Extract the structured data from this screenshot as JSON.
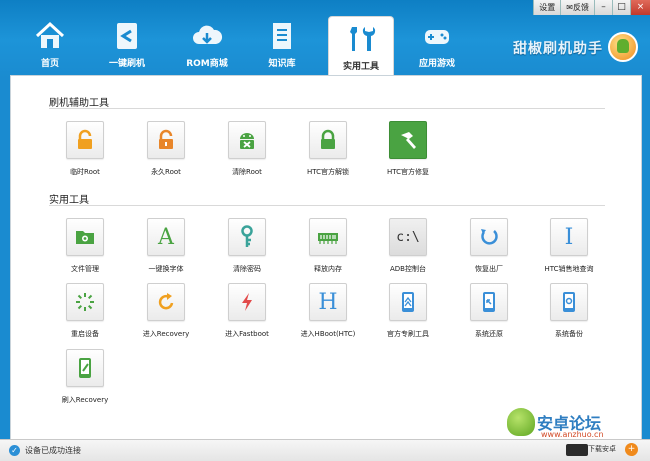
{
  "window_controls": {
    "settings": "设置",
    "feedback": "反馈",
    "minimize": "–",
    "maximize": "□",
    "close": "×"
  },
  "nav": {
    "tabs": [
      {
        "label": "首页",
        "icon": "home-icon"
      },
      {
        "label": "一键刷机",
        "icon": "flash-icon"
      },
      {
        "label": "ROM商城",
        "icon": "cloud-download-icon"
      },
      {
        "label": "知识库",
        "icon": "document-icon"
      },
      {
        "label": "实用工具",
        "icon": "tools-icon",
        "active": true
      },
      {
        "label": "应用游戏",
        "icon": "gamepad-icon"
      }
    ]
  },
  "brand": {
    "title": "甜椒刷机助手"
  },
  "sections": {
    "flash_tools": {
      "title": "刷机辅助工具",
      "items": [
        {
          "label": "临时Root",
          "icon": "unlock-icon"
        },
        {
          "label": "永久Root",
          "icon": "unlock-icon"
        },
        {
          "label": "清除Root",
          "icon": "android-remove-icon"
        },
        {
          "label": "HTC官方解锁",
          "icon": "lock-icon"
        },
        {
          "label": "HTC官方修复",
          "icon": "hammer-icon"
        }
      ]
    },
    "utilities": {
      "title": "实用工具",
      "items": [
        {
          "label": "文件管理",
          "icon": "folder-icon"
        },
        {
          "label": "一键换字体",
          "icon": "font-icon",
          "glyph": "A"
        },
        {
          "label": "清除密码",
          "icon": "key-icon"
        },
        {
          "label": "释放内存",
          "icon": "memory-icon"
        },
        {
          "label": "ADB控制台",
          "icon": "console-icon",
          "glyph": "c:\\"
        },
        {
          "label": "恢复出厂",
          "icon": "restore-icon"
        },
        {
          "label": "HTC销售地查询",
          "icon": "info-icon",
          "glyph": "I"
        },
        {
          "label": "重启设备",
          "icon": "reboot-icon"
        },
        {
          "label": "进入Recovery",
          "icon": "refresh-icon"
        },
        {
          "label": "进入Fastboot",
          "icon": "lightning-icon"
        },
        {
          "label": "进入HBoot(HTC)",
          "icon": "hboot-icon",
          "glyph": "H"
        },
        {
          "label": "官方专刷工具",
          "icon": "phone-flash-icon"
        },
        {
          "label": "系统还原",
          "icon": "system-restore-icon"
        },
        {
          "label": "系统备份",
          "icon": "system-backup-icon"
        },
        {
          "label": "刷入Recovery",
          "icon": "flash-recovery-icon"
        }
      ]
    }
  },
  "status": {
    "text": "设备已成功连接"
  },
  "watermark": {
    "title": "安卓论坛",
    "url": "www.anzhuo.cn"
  },
  "download": {
    "text": "下载安卓"
  },
  "colors": {
    "header": "#1a8bd0",
    "icon_green": "#4aa342",
    "icon_orange": "#f0a020",
    "icon_blue": "#3a8fd8",
    "icon_red": "#e24a4a"
  }
}
